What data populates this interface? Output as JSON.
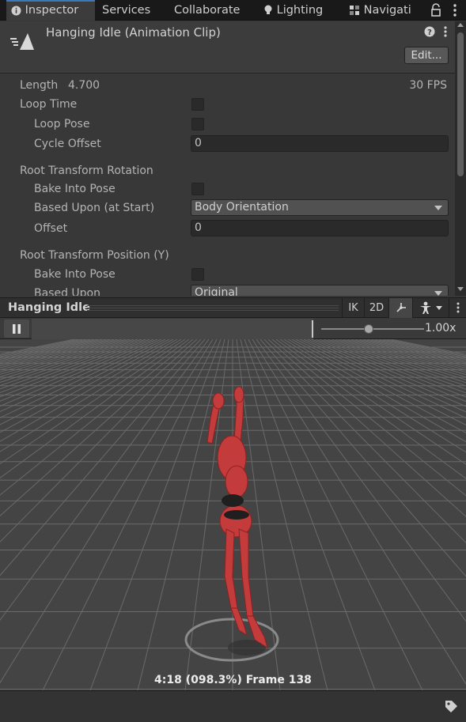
{
  "tabs": [
    {
      "label": "Inspector",
      "icon": "info-icon",
      "active": true
    },
    {
      "label": "Services",
      "active": false
    },
    {
      "label": "Collaborate",
      "active": false
    },
    {
      "label": "Lighting",
      "icon": "lightbulb-icon",
      "active": false
    },
    {
      "label": "Navigati",
      "icon": "navigation-icon",
      "active": false
    }
  ],
  "header": {
    "title": "Hanging Idle (Animation Clip)",
    "edit_label": "Edit..."
  },
  "properties": {
    "length_label": "Length",
    "length_value": "4.700",
    "fps": "30 FPS",
    "loop_time": "Loop Time",
    "loop_pose": "Loop Pose",
    "cycle_offset": "Cycle Offset",
    "cycle_offset_value": "0",
    "root_rotation": "Root Transform Rotation",
    "bake_into_pose_1": "Bake Into Pose",
    "based_upon_start": "Based Upon (at Start)",
    "based_upon_start_value": "Body Orientation",
    "offset": "Offset",
    "offset_value": "0",
    "root_position_y": "Root Transform Position (Y)",
    "bake_into_pose_2": "Bake Into Pose",
    "based_upon": "Based Upon",
    "based_upon_value": "Original"
  },
  "preview": {
    "title": "Hanging Idle",
    "ik_label": "IK",
    "twod_label": "2D",
    "speed": "1.00x",
    "speed_fraction": 0.46,
    "frame_info": "4:18 (098.3%) Frame 138"
  },
  "colors": {
    "accent": "#3a79bb",
    "character": "#c43b3b",
    "grid_line": "#6a6a6a"
  }
}
